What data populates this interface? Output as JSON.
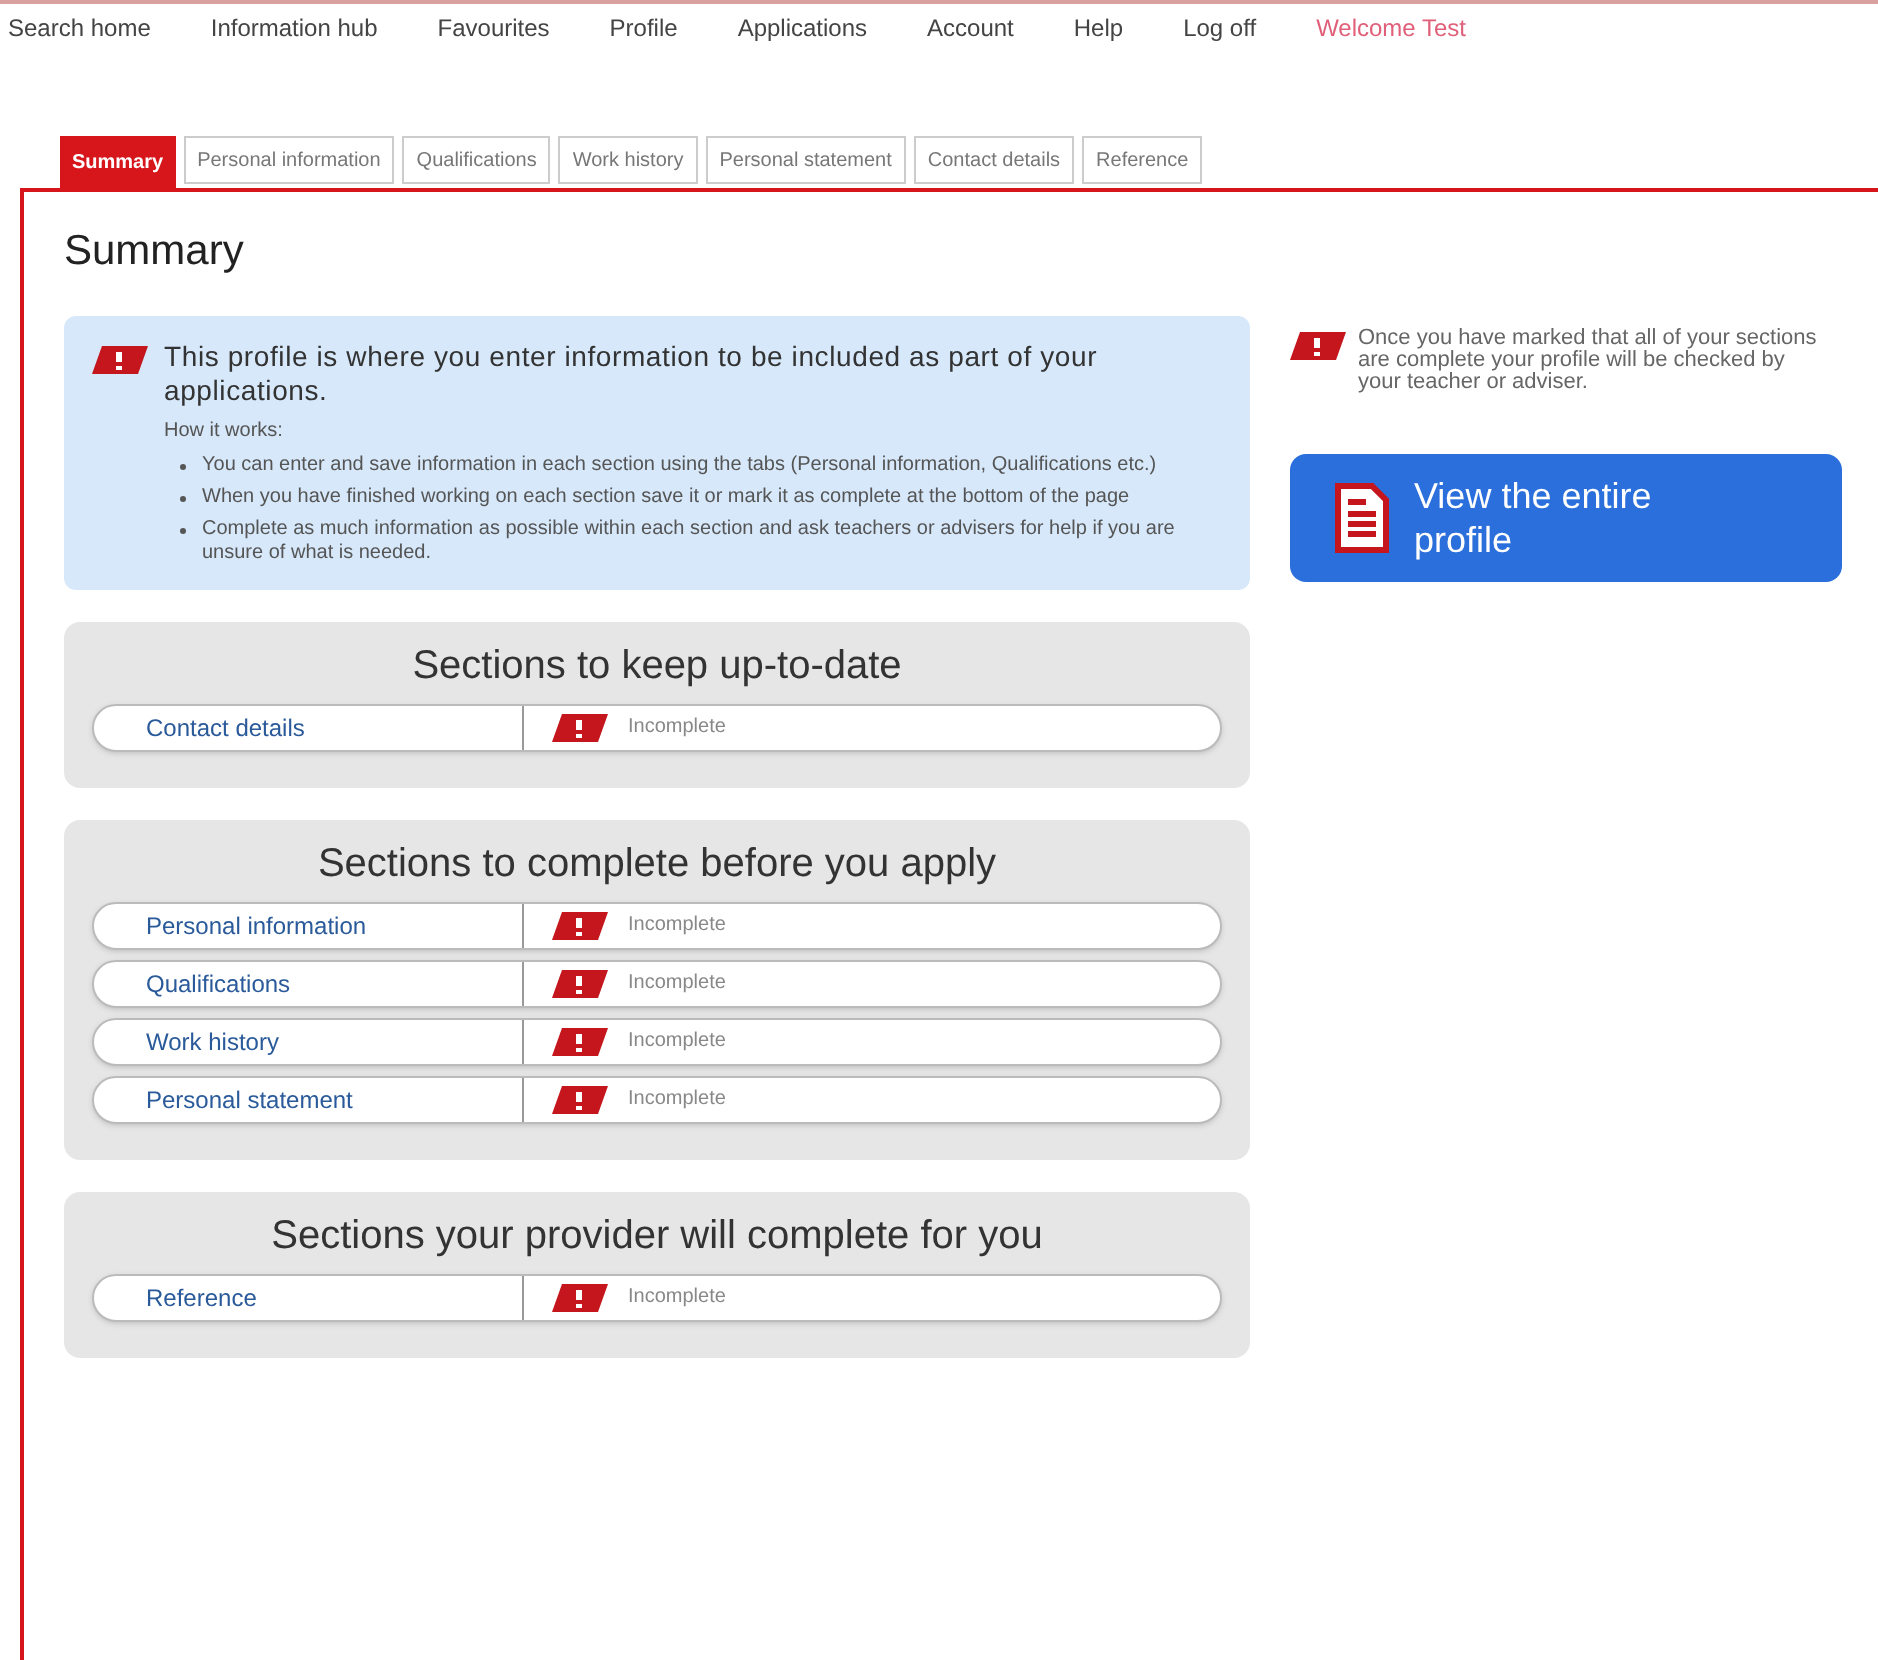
{
  "nav": [
    {
      "label": "Search home",
      "kind": "link"
    },
    {
      "label": "Information hub",
      "kind": "link"
    },
    {
      "label": "Favourites",
      "kind": "link"
    },
    {
      "label": "Profile",
      "kind": "link"
    },
    {
      "label": "Applications",
      "kind": "link"
    },
    {
      "label": "Account",
      "kind": "link"
    },
    {
      "label": "Help",
      "kind": "link"
    },
    {
      "label": "Log off",
      "kind": "link"
    },
    {
      "label": "Welcome Test",
      "kind": "greeting"
    }
  ],
  "tabs": [
    {
      "label": "Summary",
      "selected": true
    },
    {
      "label": "Personal information",
      "selected": false
    },
    {
      "label": "Qualifications",
      "selected": false
    },
    {
      "label": "Work history",
      "selected": false
    },
    {
      "label": "Personal statement",
      "selected": false
    },
    {
      "label": "Contact details",
      "selected": false
    },
    {
      "label": "Reference",
      "selected": false
    }
  ],
  "page_title": "Summary",
  "info": {
    "heading": "This profile is where you enter information to be included as part of your applications.",
    "subheading": "How it works:",
    "bullets": [
      "You can enter and save information in each section using the tabs (Personal information, Qualifications etc.)",
      "When you have finished working on each section save it or mark it as complete at the bottom of the page",
      "Complete as much information as possible within each section and ask teachers or advisers for help if you are unsure of what is needed."
    ]
  },
  "side_note": "Once you have marked that all of your sections are complete your profile will be checked by your teacher or adviser.",
  "view_button": "View the entire profile",
  "groups": [
    {
      "title": "Sections to keep up-to-date",
      "rows": [
        {
          "name": "Contact details",
          "status": "Incomplete",
          "kind": "incomplete"
        }
      ]
    },
    {
      "title": "Sections to complete before you apply",
      "rows": [
        {
          "name": "Personal information",
          "status": "Incomplete",
          "kind": "incomplete"
        },
        {
          "name": "Qualifications",
          "status": "Incomplete",
          "kind": "incomplete"
        },
        {
          "name": "Work history",
          "status": "Incomplete",
          "kind": "incomplete"
        },
        {
          "name": "Personal statement",
          "status": "Incomplete",
          "kind": "incomplete"
        }
      ]
    },
    {
      "title": "Sections your provider will complete for you",
      "rows": [
        {
          "name": "Reference",
          "status": "Incomplete",
          "kind": "incomplete"
        }
      ]
    }
  ]
}
